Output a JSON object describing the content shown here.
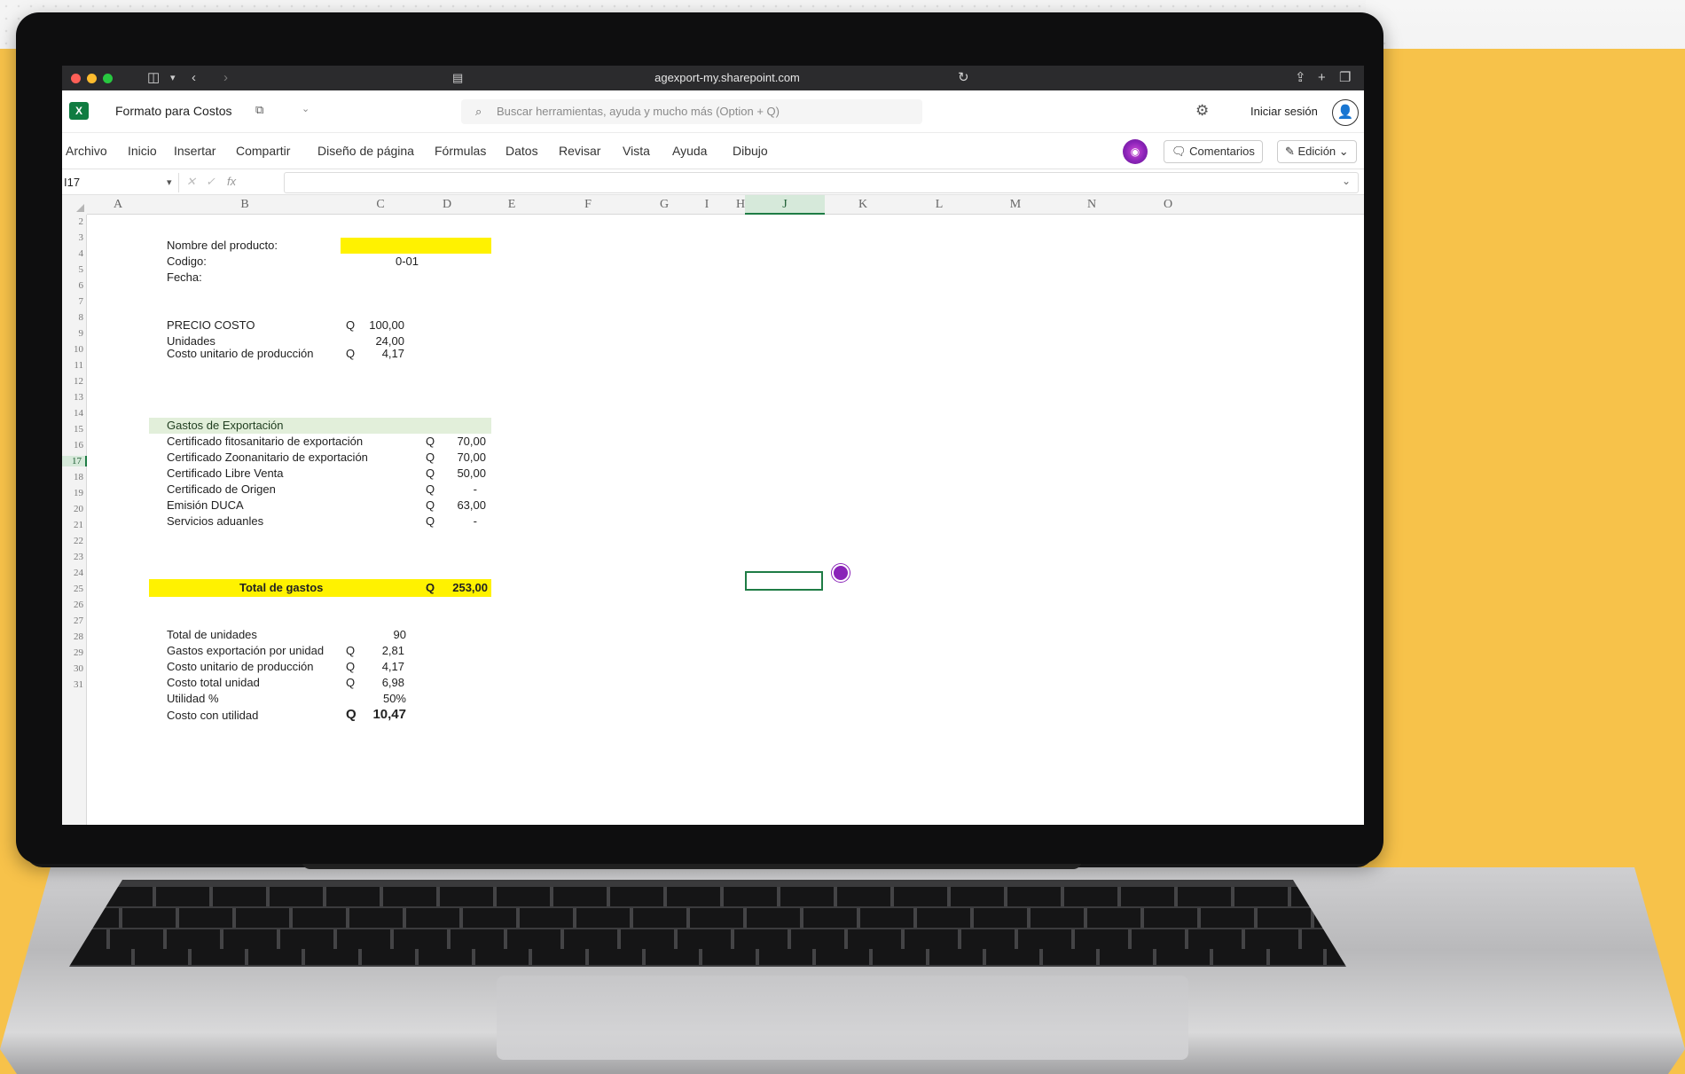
{
  "browser": {
    "url": "agexport-my.sharepoint.com"
  },
  "excel": {
    "title": "Formato para Costos",
    "search_placeholder": "Buscar herramientas, ayuda y mucho más (Option + Q)",
    "login_label": "Iniciar sesión",
    "tabs": [
      "Archivo",
      "Inicio",
      "Insertar",
      "Compartir",
      "Diseño de página",
      "Fórmulas",
      "Datos",
      "Revisar",
      "Vista",
      "Ayuda",
      "Dibujo"
    ],
    "comments_label": "Comentarios",
    "edit_label": "Edición",
    "name_box": "I17",
    "fx_label": "fx"
  },
  "grid": {
    "columns": [
      "A",
      "B",
      "C",
      "D",
      "E",
      "F",
      "G",
      "H",
      "I",
      "J",
      "K",
      "L",
      "M",
      "N",
      "O"
    ],
    "selected_column": "J",
    "rows": [
      "2",
      "3",
      "4",
      "5",
      "6",
      "7",
      "8",
      "9",
      "10",
      "11",
      "12",
      "13",
      "14",
      "15",
      "16",
      "17",
      "18",
      "19",
      "20",
      "21",
      "22",
      "23",
      "24",
      "25",
      "26",
      "27",
      "28",
      "29",
      "30",
      "31"
    ],
    "selected_row": "17"
  },
  "sheet": {
    "producto_label": "Nombre del producto:",
    "codigo_label": "Codigo:",
    "codigo_value": "0-01",
    "fecha_label": "Fecha:",
    "precio_label": "PRECIO COSTO",
    "precio_cur": "Q",
    "precio_value": "100,00",
    "unidades_label": "Unidades",
    "unidades_value": "24,00",
    "costo_unit_label": "Costo unitario de producción",
    "costo_unit_cur": "Q",
    "costo_unit_value": "4,17",
    "gastos_header": "Gastos de Exportación",
    "gastos": [
      {
        "label": "Certificado fitosanitario de exportación",
        "cur": "Q",
        "value": "70,00"
      },
      {
        "label": "Certificado Zoonanitario de exportación",
        "cur": "Q",
        "value": "70,00"
      },
      {
        "label": "Certificado Libre Venta",
        "cur": "Q",
        "value": "50,00"
      },
      {
        "label": "Certificado de Origen",
        "cur": "Q",
        "value": "-"
      },
      {
        "label": "Emisión DUCA",
        "cur": "Q",
        "value": "63,00"
      },
      {
        "label": "Servicios aduanles",
        "cur": "Q",
        "value": "-"
      }
    ],
    "total_gastos_label": "Total de gastos",
    "total_gastos_cur": "Q",
    "total_gastos_value": "253,00",
    "summary": [
      {
        "label": "Total de unidades",
        "cur": "",
        "value": "90"
      },
      {
        "label": "Gastos exportación por unidad",
        "cur": "Q",
        "value": "2,81"
      },
      {
        "label": "Costo unitario de producción",
        "cur": "Q",
        "value": "4,17"
      },
      {
        "label": "Costo total unidad",
        "cur": "Q",
        "value": "6,98"
      },
      {
        "label": "Utilidad %",
        "cur": "",
        "value": "50%"
      }
    ],
    "final_label": "Costo con utilidad",
    "final_cur": "Q",
    "final_value": "10,47"
  },
  "colors": {
    "background": "#f7c24a",
    "excel_green": "#107c41",
    "highlight_yellow": "#fff200",
    "header_green": "#e2efda",
    "presence_purple": "#8a23b8"
  }
}
